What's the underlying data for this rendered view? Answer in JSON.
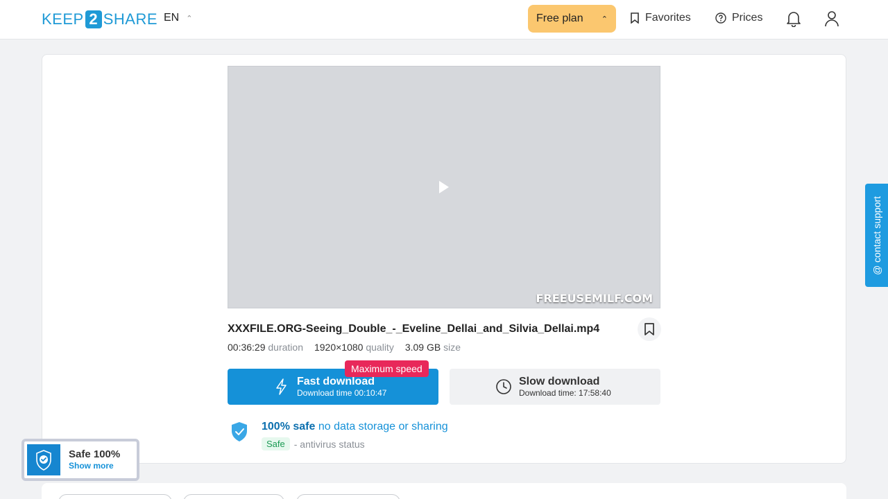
{
  "header": {
    "logo_left": "KEEP",
    "logo_mid": "2",
    "logo_right": "SHARE",
    "language": "EN",
    "plan_label": "Free plan",
    "favorites_label": "Favorites",
    "prices_label": "Prices"
  },
  "file": {
    "name": "XXXFILE.ORG-Seeing_Double_-_Eveline_Dellai_and_Silvia_Dellai.mp4",
    "thumbnail_watermark": "FREEUSEMILF.COM",
    "duration_value": "00:36:29",
    "duration_unit": "duration",
    "quality_value": "1920×1080",
    "quality_unit": "quality",
    "size_value": "3.09 GB",
    "size_unit": "size"
  },
  "download": {
    "fast_label": "Fast download",
    "fast_time": "Download time 00:10:47",
    "max_speed_badge": "Maximum speed",
    "slow_label": "Slow download",
    "slow_time": "Download time: 17:58:40"
  },
  "safety": {
    "headline_bold": "100% safe",
    "headline_rest": "no data storage or sharing",
    "status_pill": "Safe",
    "status_text": "- antivirus status"
  },
  "sidebar_tab": {
    "label": "@ contact support"
  },
  "safe_widget": {
    "title": "Safe 100%",
    "link": "Show more"
  },
  "colors": {
    "brand_blue": "#1591d8",
    "plan_yellow": "#fbc76f",
    "badge_red": "#e8285a"
  }
}
